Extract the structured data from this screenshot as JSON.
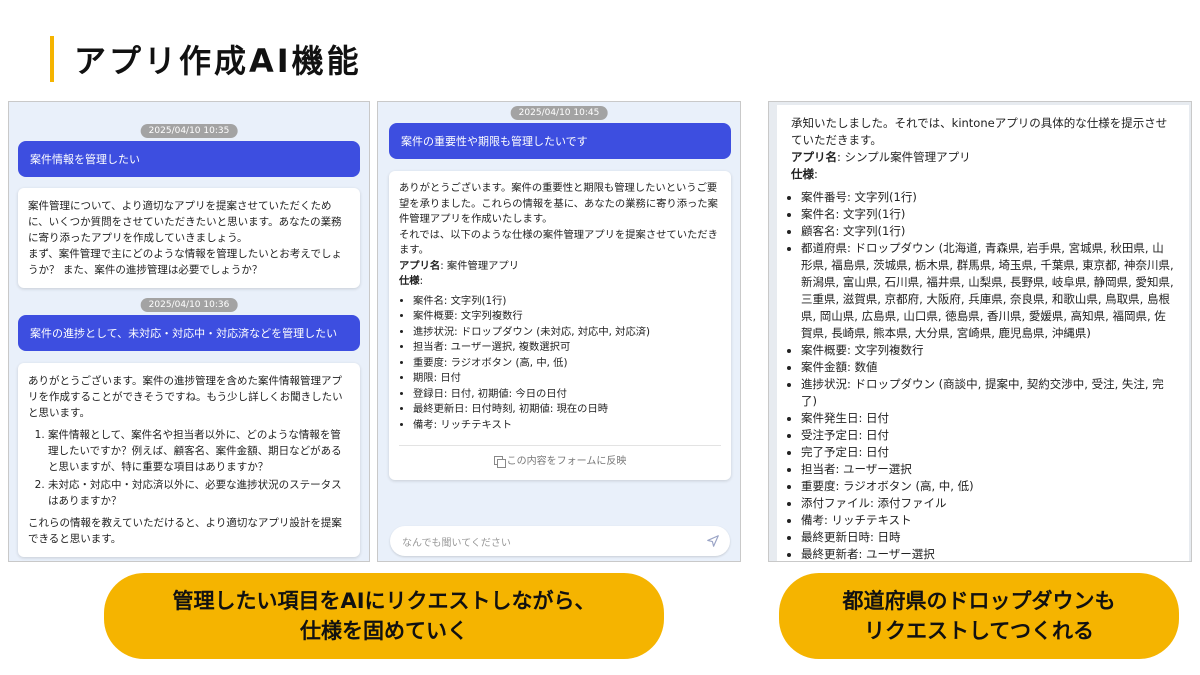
{
  "page": {
    "title": "アプリ作成AI機能"
  },
  "chat1": {
    "stamp1": "2025/04/10 10:35",
    "user1": "案件情報を管理したい",
    "ai1_p1": "案件管理について、より適切なアプリを提案させていただくために、いくつか質問をさせていただきたいと思います。あなたの業務に寄り添ったアプリを作成していきましょう。",
    "ai1_p2": "まず、案件管理で主にどのような情報を管理したいとお考えでしょうか？ また、案件の進捗管理は必要でしょうか？",
    "stamp2": "2025/04/10 10:36",
    "user2": "案件の進捗として、未対応・対応中・対応済などを管理したい",
    "ai2_p1": "ありがとうございます。案件の進捗管理を含めた案件情報管理アプリを作成することができそうですね。もう少し詳しくお聞きしたいと思います。",
    "ai2_q1": "案件情報として、案件名や担当者以外に、どのような情報を管理したいですか？例えば、顧客名、案件金額、期日などがあると思いますが、特に重要な項目はありますか？",
    "ai2_q2": "未対応・対応中・対応済以外に、必要な進捗状況のステータスはありますか？",
    "ai2_p2": "これらの情報を教えていただけると、より適切なアプリ設計を提案できると思います。"
  },
  "chat2": {
    "stamp": "2025/04/10 10:45",
    "user": "案件の重要性や期限も管理したいです",
    "ai_p1": "ありがとうございます。案件の重要性と期限も管理したいというご要望を承りました。これらの情報を基に、あなたの業務に寄り添った案件管理アプリを作成いたします。",
    "ai_p2": "それでは、以下のような仕様の案件管理アプリを提案させていただきます。",
    "app_name_label": "アプリ名",
    "app_name": ": 案件管理アプリ",
    "spec_label": "仕様",
    "spec_colon": ":",
    "fields": [
      "案件名: 文字列(1行)",
      "案件概要: 文字列複数行",
      "進捗状況: ドロップダウン (未対応, 対応中, 対応済)",
      "担当者: ユーザー選択, 複数選択可",
      "重要度: ラジオボタン (高, 中, 低)",
      "期限: 日付",
      "登録日: 日付, 初期値: 今日の日付",
      "最終更新日: 日付時刻, 初期値: 現在の日時",
      "備考: リッチテキスト"
    ],
    "reflect_label": "この内容をフォームに反映",
    "input_placeholder": "なんでも聞いてください"
  },
  "spec": {
    "intro": "承知いたしました。それでは、kintoneアプリの具体的な仕様を提示させていただきます。",
    "app_name_label": "アプリ名",
    "app_name": ": シンプル案件管理アプリ",
    "spec_label": "仕様",
    "spec_colon": ":",
    "fields": [
      "案件番号: 文字列(1行)",
      "案件名: 文字列(1行)",
      "顧客名: 文字列(1行)",
      "都道府県: ドロップダウン (北海道, 青森県, 岩手県, 宮城県, 秋田県, 山形県, 福島県, 茨城県, 栃木県, 群馬県, 埼玉県, 千葉県, 東京都, 神奈川県, 新潟県, 富山県, 石川県, 福井県, 山梨県, 長野県, 岐阜県, 静岡県, 愛知県, 三重県, 滋賀県, 京都府, 大阪府, 兵庫県, 奈良県, 和歌山県, 鳥取県, 島根県, 岡山県, 広島県, 山口県, 徳島県, 香川県, 愛媛県, 高知県, 福岡県, 佐賀県, 長崎県, 熊本県, 大分県, 宮崎県, 鹿児島県, 沖縄県)",
      "案件概要: 文字列複数行",
      "案件金額: 数値",
      "進捗状況: ドロップダウン (商談中, 提案中, 契約交渉中, 受注, 失注, 完了)",
      "案件発生日: 日付",
      "受注予定日: 日付",
      "完了予定日: 日付",
      "担当者: ユーザー選択",
      "重要度: ラジオボタン (高, 中, 低)",
      "添付ファイル: 添付ファイル",
      "備考: リッチテキスト",
      "最終更新日時: 日時",
      "最終更新者: ユーザー選択"
    ]
  },
  "captions": {
    "left_line1": "管理したい項目をAIにリクエストしながら、",
    "left_line2": "仕様を固めていく",
    "right_line1": "都道府県のドロップダウンも",
    "right_line2": "リクエストしてつくれる"
  },
  "colors": {
    "accent": "#f5b400",
    "user_bubble": "#3d4ee0"
  }
}
